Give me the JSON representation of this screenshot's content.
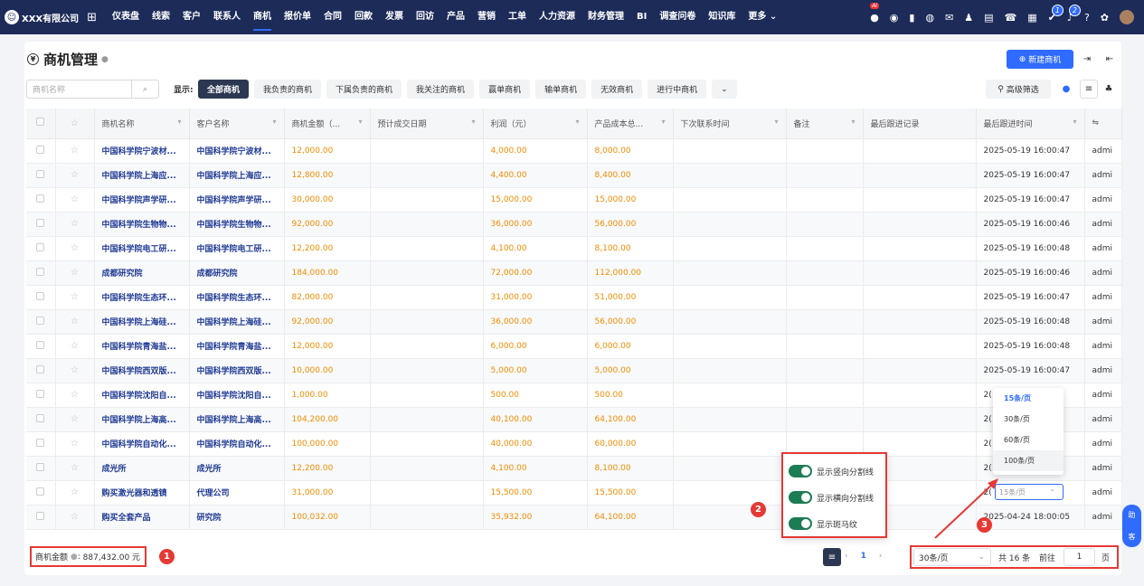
{
  "topbar": {
    "brand": "XXX有限公司",
    "nav": [
      "仪表盘",
      "线索",
      "客户",
      "联系人",
      "商机",
      "报价单",
      "合同",
      "回款",
      "发票",
      "回访",
      "产品",
      "营销",
      "工单",
      "人力资源",
      "财务管理",
      "BI",
      "调查问卷",
      "知识库",
      "更多"
    ],
    "active_nav": "商机",
    "ai_badge": "AI",
    "notif_count_1": "1",
    "notif_count_2": "2"
  },
  "page": {
    "title": "商机管理",
    "new_button": "新建商机",
    "search_placeholder": "商机名称",
    "show_label": "显示:",
    "filters": [
      "全部商机",
      "我负责的商机",
      "下属负责的商机",
      "我关注的商机",
      "赢单商机",
      "输单商机",
      "无效商机",
      "进行中商机"
    ],
    "advanced_filter": "高级筛选"
  },
  "table": {
    "columns": [
      "商机名称",
      "客户名称",
      "商机金额（...",
      "预计成交日期",
      "利润（元）",
      "产品成本总...",
      "下次联系时间",
      "备注",
      "最后跟进记录",
      "最后跟进时间"
    ],
    "rows": [
      [
        "中国科学院宁波材...",
        "中国科学院宁波材...",
        "12,000.00",
        "",
        "4,000.00",
        "8,000.00",
        "",
        "",
        "",
        "2025-05-19 16:00:47",
        "admi"
      ],
      [
        "中国科学院上海应...",
        "中国科学院上海应...",
        "12,800.00",
        "",
        "4,400.00",
        "8,400.00",
        "",
        "",
        "",
        "2025-05-19 16:00:47",
        "admi"
      ],
      [
        "中国科学院声学研...",
        "中国科学院声学研...",
        "30,000.00",
        "",
        "15,000.00",
        "15,000.00",
        "",
        "",
        "",
        "2025-05-19 16:00:47",
        "admi"
      ],
      [
        "中国科学院生物物...",
        "中国科学院生物物...",
        "92,000.00",
        "",
        "36,000.00",
        "56,000.00",
        "",
        "",
        "",
        "2025-05-19 16:00:46",
        "admi"
      ],
      [
        "中国科学院电工研...",
        "中国科学院电工研...",
        "12,200.00",
        "",
        "4,100.00",
        "8,100.00",
        "",
        "",
        "",
        "2025-05-19 16:00:48",
        "admi"
      ],
      [
        "成都研究院",
        "成都研究院",
        "184,000.00",
        "",
        "72,000.00",
        "112,000.00",
        "",
        "",
        "",
        "2025-05-19 16:00:46",
        "admi"
      ],
      [
        "中国科学院生态环...",
        "中国科学院生态环...",
        "82,000.00",
        "",
        "31,000.00",
        "51,000.00",
        "",
        "",
        "",
        "2025-05-19 16:00:47",
        "admi"
      ],
      [
        "中国科学院上海硅...",
        "中国科学院上海硅...",
        "92,000.00",
        "",
        "36,000.00",
        "56,000.00",
        "",
        "",
        "",
        "2025-05-19 16:00:48",
        "admi"
      ],
      [
        "中国科学院青海盐...",
        "中国科学院青海盐...",
        "12,000.00",
        "",
        "6,000.00",
        "6,000.00",
        "",
        "",
        "",
        "2025-05-19 16:00:48",
        "admi"
      ],
      [
        "中国科学院西双版...",
        "中国科学院西双版...",
        "10,000.00",
        "",
        "5,000.00",
        "5,000.00",
        "",
        "",
        "",
        "2025-05-19 16:00:47",
        "admi"
      ],
      [
        "中国科学院沈阳自...",
        "中国科学院沈阳自...",
        "1,000.00",
        "",
        "500.00",
        "500.00",
        "",
        "",
        "",
        "2(",
        "admi"
      ],
      [
        "中国科学院上海高...",
        "中国科学院上海高...",
        "104,200.00",
        "",
        "40,100.00",
        "64,100.00",
        "",
        "",
        "",
        "2(",
        "admi"
      ],
      [
        "中国科学院自动化...",
        "中国科学院自动化...",
        "100,000.00",
        "",
        "40,000.00",
        "60,000.00",
        "",
        "",
        "",
        "2(",
        "admi"
      ],
      [
        "成光所",
        "成光所",
        "12,200.00",
        "",
        "4,100.00",
        "8,100.00",
        "",
        "",
        "",
        "2(",
        "admi"
      ],
      [
        "购买激光器和透镜",
        "代理公司",
        "31,000.00",
        "",
        "15,500.00",
        "15,500.00",
        "",
        "",
        "",
        "2(",
        "admi"
      ],
      [
        "购买全套产品",
        "研究院",
        "100,032.00",
        "",
        "35,932.00",
        "64,100.00",
        "",
        "",
        "",
        "2025-04-24 18:00:05",
        "admi"
      ]
    ]
  },
  "footer": {
    "sum_label": "商机金额",
    "sum_value": "887,432.00 元",
    "current_page": "1",
    "page_size": "30条/页",
    "total": "共 16 条",
    "goto": "前往",
    "page_input": "1",
    "page_unit": "页"
  },
  "popup": {
    "toggles": [
      "显示竖向分割线",
      "显示横向分割线",
      "显示斑马纹"
    ]
  },
  "page_size_dropdown": {
    "options": [
      "15条/页",
      "30条/页",
      "60条/页",
      "100条/页"
    ],
    "selected": "15条/页",
    "open_value": "15条/页"
  },
  "annotations": [
    "1",
    "2",
    "3"
  ],
  "float_tools": [
    "助",
    "客"
  ],
  "colors": {
    "accent": "#2f6bff",
    "topbar": "#1d2b59",
    "amount": "#f08c00",
    "callout": "#e53935",
    "toggle": "#1c7c54"
  }
}
